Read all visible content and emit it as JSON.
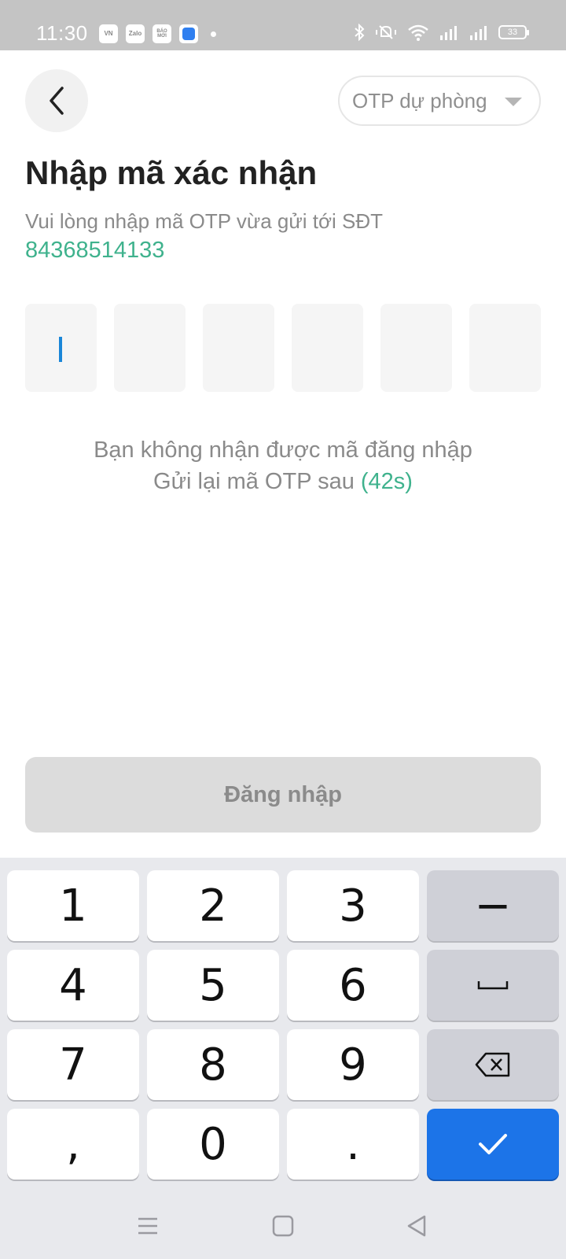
{
  "status_bar": {
    "time": "11:30",
    "notif_icons": [
      {
        "name": "vnexpress-icon",
        "text": "VN"
      },
      {
        "name": "zalo-icon",
        "text": "Zalo"
      },
      {
        "name": "baomoi-icon",
        "text": "BÁO MỚI"
      },
      {
        "name": "blue-app-icon",
        "text": ""
      }
    ],
    "battery_level": "33"
  },
  "header": {
    "otp_dropdown_label": "OTP dự phòng"
  },
  "content": {
    "title": "Nhập mã xác nhận",
    "subtitle": "Vui lòng nhập mã OTP vừa gửi tới SĐT",
    "phone_number": "84368514133",
    "otp_digits": [
      "",
      "",
      "",
      "",
      "",
      ""
    ],
    "resend_line1": "Bạn không nhận được mã đăng nhập",
    "resend_prefix": "Gửi lại mã OTP sau",
    "resend_countdown": "(42s)",
    "login_button": "Đăng nhập"
  },
  "keyboard": {
    "rows": [
      [
        "1",
        "2",
        "3",
        "−"
      ],
      [
        "4",
        "5",
        "6",
        "space"
      ],
      [
        "7",
        "8",
        "9",
        "backspace"
      ],
      [
        ",",
        "0",
        ".",
        "enter"
      ]
    ]
  },
  "colors": {
    "accent_green": "#3fb28d",
    "keyboard_enter": "#1c74e8",
    "cursor": "#1a86d8"
  }
}
